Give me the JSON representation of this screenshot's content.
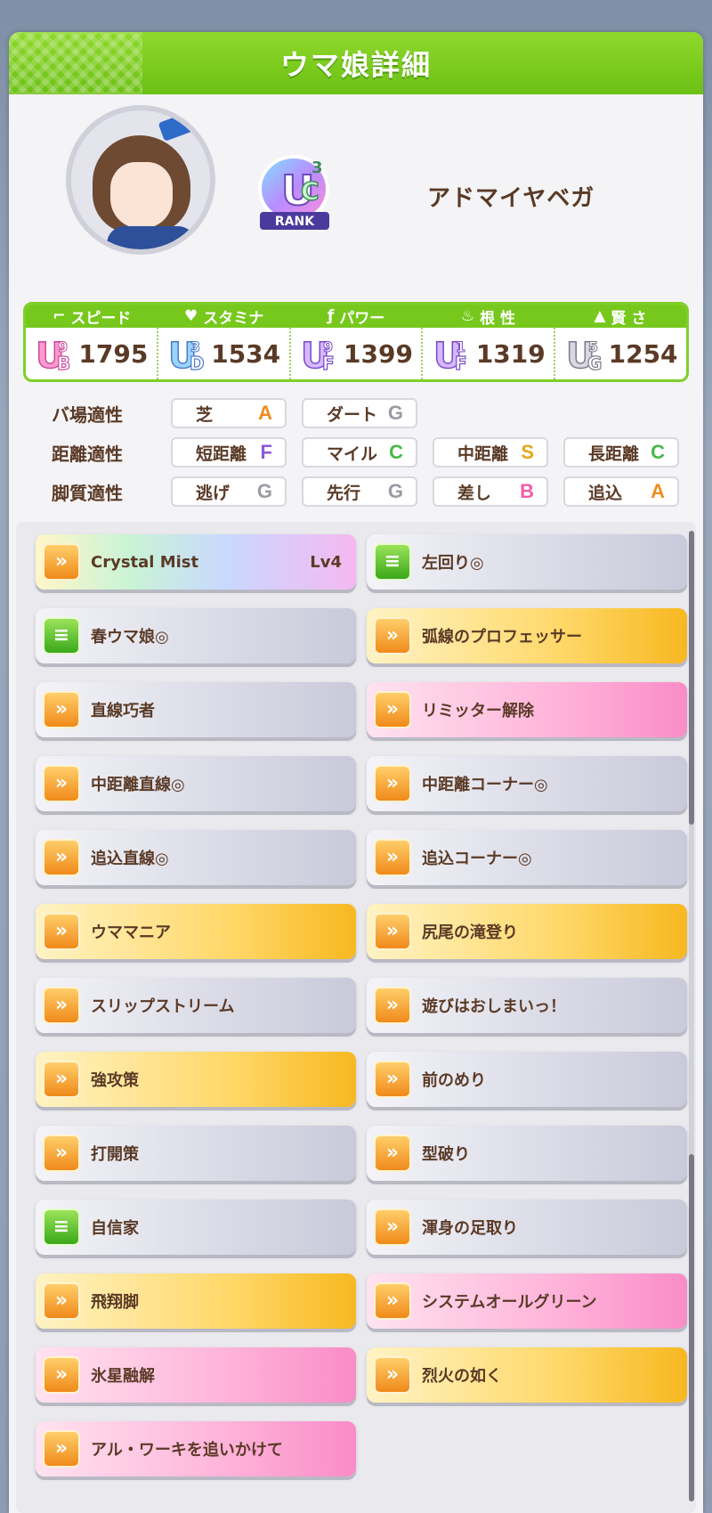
{
  "header": {
    "title": "ウマ娘詳細"
  },
  "profile": {
    "name": "アドマイヤベガ",
    "rank": {
      "letter_u": "U",
      "letter_c": "C",
      "tier": "3",
      "label": "RANK"
    }
  },
  "stats": [
    {
      "label": "スピード",
      "icon": "shoe-icon",
      "grade_letter": "B",
      "grade_num": "9",
      "value": "1795"
    },
    {
      "label": "スタミナ",
      "icon": "heart-icon",
      "grade_letter": "D",
      "grade_num": "3",
      "value": "1534"
    },
    {
      "label": "パワー",
      "icon": "arm-icon",
      "grade_letter": "F",
      "grade_num": "9",
      "value": "1399"
    },
    {
      "label": "根 性",
      "icon": "flame-icon",
      "grade_letter": "F",
      "grade_num": "1",
      "value": "1319"
    },
    {
      "label": "賢 さ",
      "icon": "mortarboard-icon",
      "grade_letter": "G",
      "grade_num": "5",
      "value": "1254"
    }
  ],
  "aptitudes": {
    "track": {
      "label": "バ場適性",
      "items": [
        {
          "name": "芝",
          "grade": "A",
          "color": "#f28a1c"
        },
        {
          "name": "ダート",
          "grade": "G",
          "color": "#9a9aa4"
        }
      ]
    },
    "distance": {
      "label": "距離適性",
      "items": [
        {
          "name": "短距離",
          "grade": "F",
          "color": "#8a5ad8"
        },
        {
          "name": "マイル",
          "grade": "C",
          "color": "#46b94a"
        },
        {
          "name": "中距離",
          "grade": "S",
          "color": "#e9a617"
        },
        {
          "name": "長距離",
          "grade": "C",
          "color": "#46b94a"
        }
      ]
    },
    "style": {
      "label": "脚質適性",
      "items": [
        {
          "name": "逃げ",
          "grade": "G",
          "color": "#9a9aa4"
        },
        {
          "name": "先行",
          "grade": "G",
          "color": "#9a9aa4"
        },
        {
          "name": "差し",
          "grade": "B",
          "color": "#f25da8"
        },
        {
          "name": "追込",
          "grade": "A",
          "color": "#f28a1c"
        }
      ]
    }
  },
  "skills": {
    "left": [
      {
        "name": "Crystal Mist",
        "level": "Lv4",
        "type": "unique",
        "icon": "speed"
      },
      {
        "name": "春ウマ娘◎",
        "type": "normal",
        "icon": "green"
      },
      {
        "name": "直線巧者",
        "type": "normal",
        "icon": "speed"
      },
      {
        "name": "中距離直線◎",
        "type": "normal",
        "icon": "speed"
      },
      {
        "name": "追込直線◎",
        "type": "normal",
        "icon": "speed"
      },
      {
        "name": "ウママニア",
        "type": "gold",
        "icon": "speed"
      },
      {
        "name": "スリップストリーム",
        "type": "normal",
        "icon": "speed"
      },
      {
        "name": "強攻策",
        "type": "gold",
        "icon": "speed"
      },
      {
        "name": "打開策",
        "type": "normal",
        "icon": "speed"
      },
      {
        "name": "自信家",
        "type": "normal",
        "icon": "green"
      },
      {
        "name": "飛翔脚",
        "type": "gold",
        "icon": "speed"
      },
      {
        "name": "氷星融解",
        "type": "pink",
        "icon": "speed"
      },
      {
        "name": "アル・ワーキを追いかけて",
        "type": "pink",
        "icon": "speed"
      }
    ],
    "right": [
      {
        "name": "左回り◎",
        "type": "normal",
        "icon": "green"
      },
      {
        "name": "弧線のプロフェッサー",
        "type": "gold",
        "icon": "speed"
      },
      {
        "name": "リミッター解除",
        "type": "pink",
        "icon": "speed"
      },
      {
        "name": "中距離コーナー◎",
        "type": "normal",
        "icon": "speed"
      },
      {
        "name": "追込コーナー◎",
        "type": "normal",
        "icon": "speed"
      },
      {
        "name": "尻尾の滝登り",
        "type": "gold",
        "icon": "speed"
      },
      {
        "name": "遊びはおしまいっ！",
        "type": "normal",
        "icon": "speed"
      },
      {
        "name": "前のめり",
        "type": "normal",
        "icon": "speed"
      },
      {
        "name": "型破り",
        "type": "normal",
        "icon": "speed"
      },
      {
        "name": "渾身の足取り",
        "type": "normal",
        "icon": "speed"
      },
      {
        "name": "システムオールグリーン",
        "type": "pink",
        "icon": "speed"
      },
      {
        "name": "烈火の如く",
        "type": "gold",
        "icon": "speed"
      }
    ]
  },
  "colors": {
    "accent_green": "#77c81c",
    "text_brown": "#5a3a26"
  }
}
